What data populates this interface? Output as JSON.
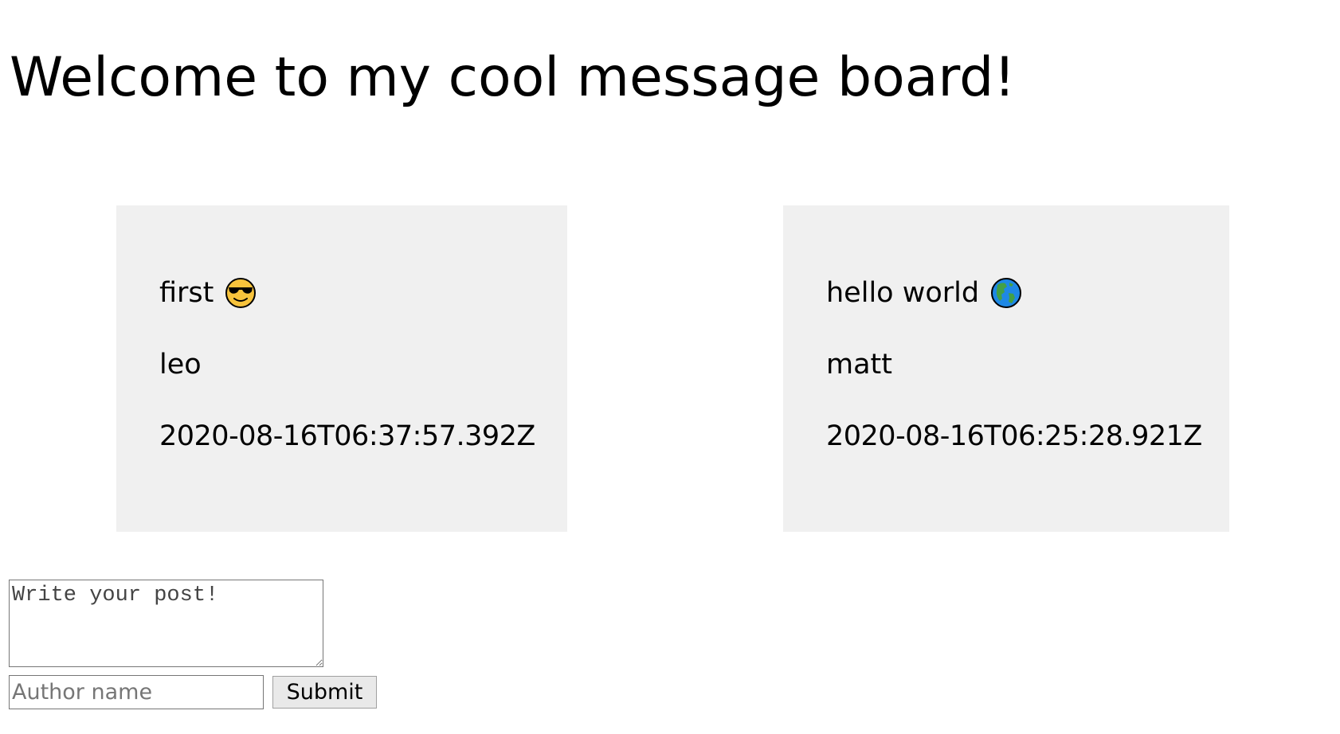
{
  "page": {
    "title": "Welcome to my cool message board!"
  },
  "posts": [
    {
      "text": "first",
      "emoji_icon": "sunglasses-face-icon",
      "author": "leo",
      "timestamp": "2020-08-16T06:37:57.392Z"
    },
    {
      "text": "hello world",
      "emoji_icon": "globe-americas-icon",
      "author": "matt",
      "timestamp": "2020-08-16T06:25:28.921Z"
    }
  ],
  "form": {
    "post_placeholder": "Write your post!",
    "post_value": "",
    "author_placeholder": "Author name",
    "author_value": "",
    "submit_label": "Submit"
  },
  "colors": {
    "card_background": "#f0f0f0",
    "text": "#000000",
    "emoji_yellow": "#f7c33c",
    "globe_blue": "#1e88e5",
    "globe_green": "#43a047"
  }
}
